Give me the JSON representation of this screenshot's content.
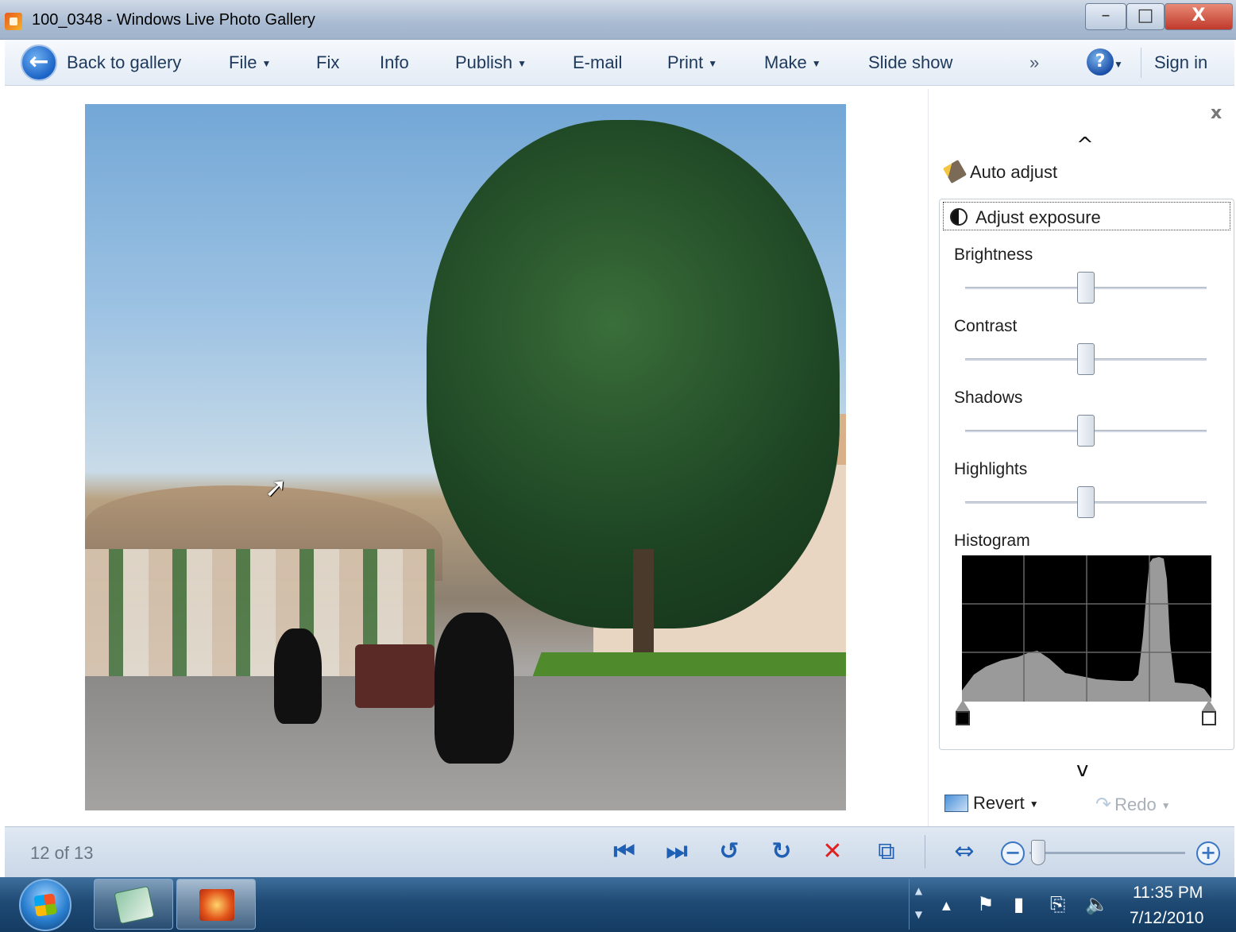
{
  "window": {
    "title": "100_0348 - Windows Live Photo Gallery",
    "minimize_glyph": "–",
    "maximize_glyph": "□",
    "close_glyph": "X"
  },
  "toolbar": {
    "back_label": "Back to gallery",
    "back_glyph": "←",
    "items": [
      "File",
      "Fix",
      "Info",
      "Publish",
      "E-mail",
      "Print",
      "Make",
      "Slide show"
    ],
    "dropdown_caret": "▼",
    "overflow_glyph": "»",
    "help_glyph": "?",
    "sign_in": "Sign in"
  },
  "fix_panel": {
    "close_glyph": "x",
    "chevron_up": "^",
    "chevron_down": "v",
    "auto_adjust": "Auto adjust",
    "adjust_exposure": "Adjust exposure",
    "sliders": [
      {
        "label": "Brightness",
        "value": 0.5
      },
      {
        "label": "Contrast",
        "value": 0.5
      },
      {
        "label": "Shadows",
        "value": 0.5
      },
      {
        "label": "Highlights",
        "value": 0.5
      }
    ],
    "histogram_label": "Histogram",
    "revert_label": "Revert",
    "redo_label": "Redo"
  },
  "bottombar": {
    "counter": "12 of 13",
    "icons": [
      "previous-icon",
      "next-icon",
      "rotate-left-icon",
      "rotate-right-icon",
      "delete-icon",
      "slideshow-icon",
      "fit-icon"
    ],
    "zoom_minus": "−",
    "zoom_plus": "+"
  },
  "taskbar": {
    "time": "11:35 PM",
    "date": "7/12/2010"
  },
  "colors": {
    "delete": "#e02020",
    "nav_blue": "#1f5fb4",
    "titlebar": "#a9bbd2"
  }
}
